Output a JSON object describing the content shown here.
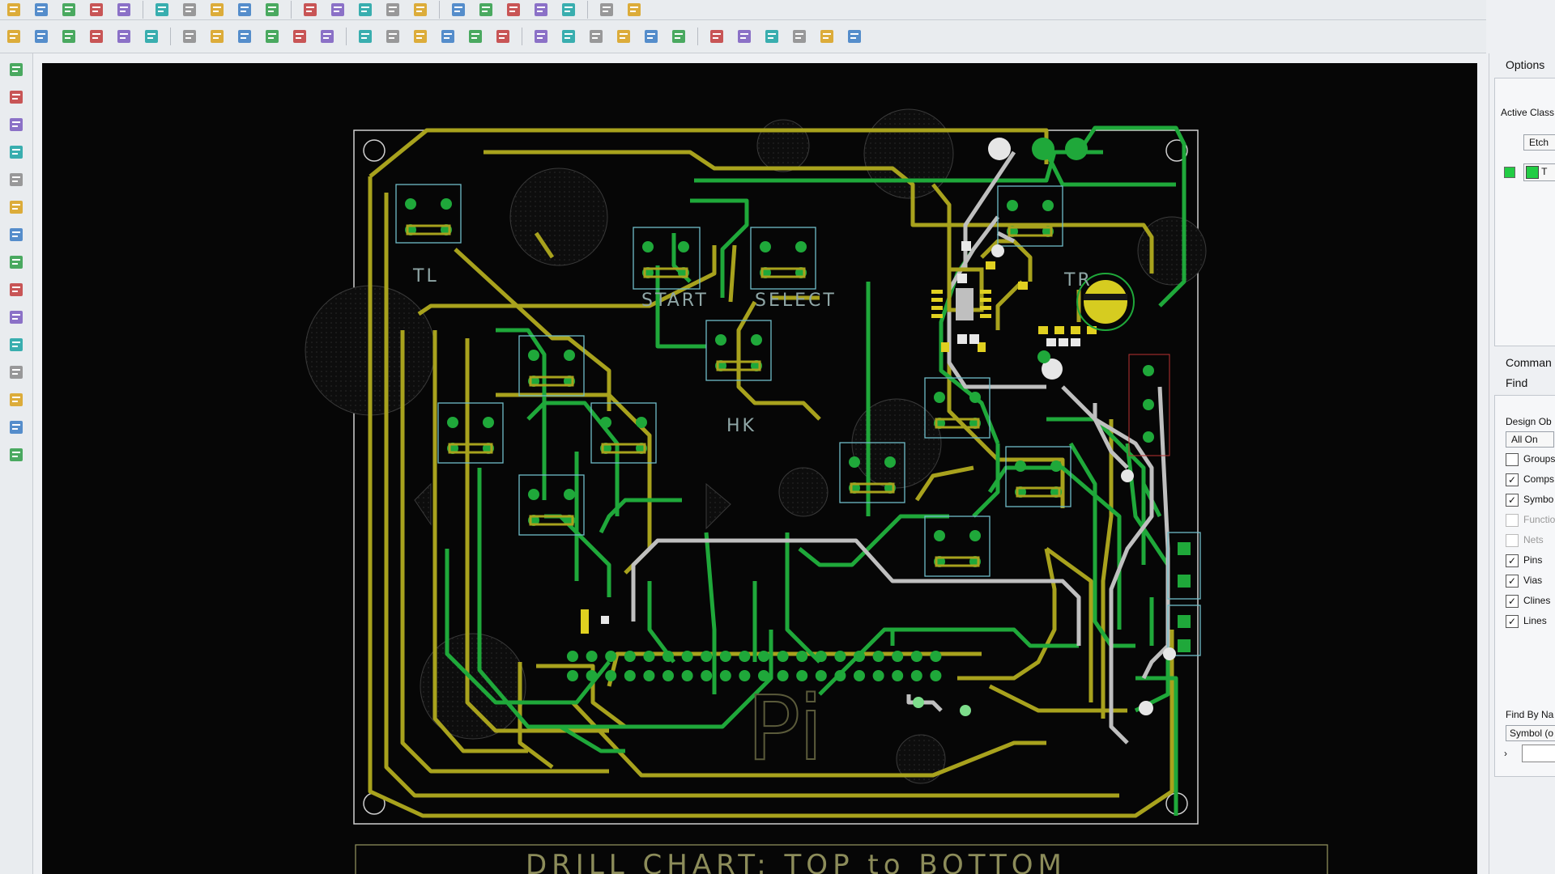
{
  "toolbar_top": {
    "icons": [
      "new-file-icon",
      "open-folder-icon",
      "save-icon",
      "move-icon",
      "copy-icon",
      "delete-icon",
      "undo-icon",
      "redo-icon",
      "pin-icon",
      "grid-icon",
      "zoom-in-icon",
      "zoom-out-icon",
      "zoom-fit-icon",
      "refresh-icon",
      "3d-view-icon",
      "layers-icon",
      "info-icon",
      "measure-icon",
      "color-icon",
      "highlight-icon",
      "drc-icon",
      "report-icon"
    ]
  },
  "toolbar_bottom": {
    "icons": [
      "layer-top-icon",
      "layer-2-icon",
      "layer-3-icon",
      "layer-4-icon",
      "layer-5-icon",
      "layer-bottom-icon",
      "route-icon",
      "rectangle-icon",
      "circle-icon",
      "select-icon",
      "via-icon",
      "shape-icon",
      "square-icon",
      "octagon-icon",
      "fill-icon",
      "placement-icon",
      "component-icon",
      "dimension-icon",
      "ruler-icon",
      "drill-icon",
      "text-icon",
      "properties-icon",
      "bom-icon",
      "hierarchy-icon",
      "matrix-icon",
      "net-icon",
      "package-icon",
      "check-icon",
      "window-icon",
      "help-icon"
    ]
  },
  "left_tools": {
    "icons": [
      "place-icon",
      "components-icon",
      "pads-icon",
      "add-connect-icon",
      "slide-icon",
      "delay-tune-icon",
      "spread-icon",
      "custom-smooth-icon",
      "vias-icon",
      "fanout-icon",
      "route-auto-icon",
      "add-line-icon",
      "add-rect-icon",
      "add-text-icon",
      "edit-text-icon"
    ]
  },
  "board": {
    "silkscreen_labels": [
      "TL",
      "START",
      "SELECT",
      "HK",
      "TR"
    ],
    "drill_chart_title": "DRILL CHART: TOP to BOTTOM",
    "logo_text": "Pi"
  },
  "options_panel": {
    "tab_label": "Options",
    "active_class_label": "Active Class",
    "active_class_value": "Etch",
    "subclass_value": "T",
    "subclass_color": "#22cc44"
  },
  "command_panel": {
    "label": "Comman"
  },
  "find_panel": {
    "label": "Find",
    "design_objects_label": "Design Ob",
    "all_on_label": "All On",
    "filters": [
      {
        "label": "Groups",
        "checked": false,
        "enabled": true
      },
      {
        "label": "Comps",
        "checked": true,
        "enabled": true
      },
      {
        "label": "Symbo",
        "checked": true,
        "enabled": true
      },
      {
        "label": "Functio",
        "checked": false,
        "enabled": false
      },
      {
        "label": "Nets",
        "checked": false,
        "enabled": false
      },
      {
        "label": "Pins",
        "checked": true,
        "enabled": true
      },
      {
        "label": "Vias",
        "checked": true,
        "enabled": true
      },
      {
        "label": "Clines",
        "checked": true,
        "enabled": true
      },
      {
        "label": "Lines",
        "checked": true,
        "enabled": true
      }
    ],
    "find_by_name_label": "Find By Na",
    "find_by_name_select": "Symbol (o",
    "find_by_name_value": ""
  },
  "colors": {
    "board_bg": "#060606",
    "outline": "#cfcfcf",
    "top_etch": "#1fa83a",
    "bottom_etch": "#a8a21d",
    "white_etch": "#bfbfbf",
    "silkscreen": "#8fa6a6"
  }
}
